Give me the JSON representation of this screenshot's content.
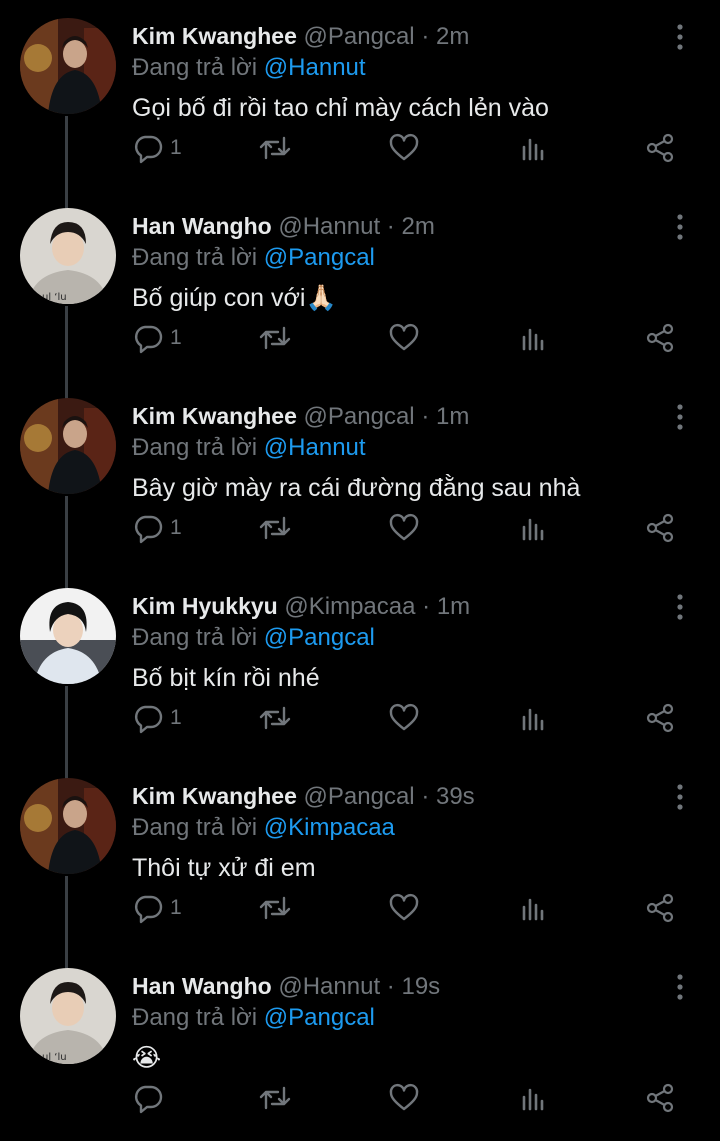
{
  "reply_prefix": "Đang trả lời",
  "separator": "·",
  "tweets": [
    {
      "name": "Kim Kwanghee",
      "handle": "@Pangcal",
      "time": "2m",
      "reply_to": "@Hannut",
      "text": "Gọi bố đi rồi tao chỉ mày cách lẻn vào",
      "reply_count": "1"
    },
    {
      "name": "Han Wangho",
      "handle": "@Hannut",
      "time": "2m",
      "reply_to": "@Pangcal",
      "text": "Bố giúp con với🙏🏻",
      "reply_count": "1"
    },
    {
      "name": "Kim Kwanghee",
      "handle": "@Pangcal",
      "time": "1m",
      "reply_to": "@Hannut",
      "text": "Bây giờ mày ra cái đường đằng sau nhà",
      "reply_count": "1"
    },
    {
      "name": "Kim Hyukkyu",
      "handle": "@Kimpacaa",
      "time": "1m",
      "reply_to": "@Pangcal",
      "text": "Bố bịt kín rồi nhé",
      "reply_count": "1"
    },
    {
      "name": "Kim Kwanghee",
      "handle": "@Pangcal",
      "time": "39s",
      "reply_to": "@Kimpacaa",
      "text": "Thôi tự xử đi em",
      "reply_count": "1"
    },
    {
      "name": "Han Wangho",
      "handle": "@Hannut",
      "time": "19s",
      "reply_to": "@Pangcal",
      "text": "😭",
      "reply_count": ""
    }
  ],
  "icons": {
    "reply": "reply-icon",
    "retweet": "retweet-icon",
    "like": "heart-icon",
    "stats": "stats-icon",
    "share": "share-icon",
    "more": "more-icon"
  },
  "colors": {
    "background": "#000000",
    "text": "#e7e9ea",
    "muted": "#71767b",
    "mention": "#1d9bf0",
    "thread_line": "#3a3f44"
  }
}
